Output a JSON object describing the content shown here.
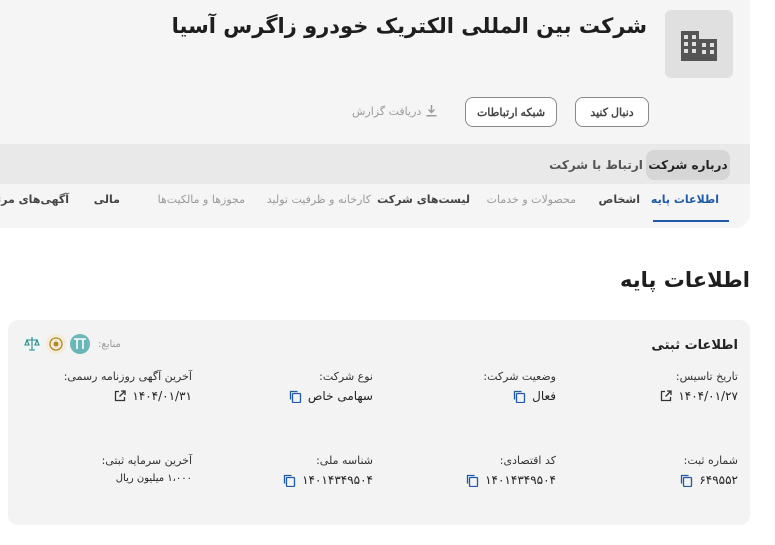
{
  "company": {
    "name": "شرکت بین المللی الکتریک خودرو زاگرس آسیا"
  },
  "actions": {
    "follow": "دنبال کنید",
    "network": "شبکه ارتباطات",
    "report": "دریافت گزارش"
  },
  "toggles": {
    "about": "درباره شرکت",
    "contact": "ارتباط با شرکت"
  },
  "tabs": [
    {
      "label": "اطلاعات پایه",
      "active": true
    },
    {
      "label": "اشخاص"
    },
    {
      "label": "محصولات و خدمات"
    },
    {
      "label": "لیست‌های شرکت"
    },
    {
      "label": "کارخانه و ظرفیت تولید"
    },
    {
      "label": "مجوزها و مالکیت‌ها"
    },
    {
      "label": "مالی"
    },
    {
      "label": "آگهی‌های مرتبط"
    }
  ],
  "section_title": "اطلاعات پایه",
  "registration": {
    "title": "اطلاعات ثبتی",
    "sources_label": "منابع:",
    "fields": [
      {
        "label": "تاریخ تاسیس:",
        "value": "۱۴۰۴/۰۱/۲۷"
      },
      {
        "label": "وضعیت شرکت:",
        "value": "فعال"
      },
      {
        "label": "نوع شرکت:",
        "value": "سهامی خاص"
      },
      {
        "label": "آخرین آگهی روزنامه رسمی:",
        "value": "۱۴۰۴/۰۱/۳۱"
      },
      {
        "label": "شماره ثبت:",
        "value": "۶۴۹۵۵۲"
      },
      {
        "label": "کد اقتصادی:",
        "value": "۱۴۰۱۴۳۴۹۵۰۴"
      },
      {
        "label": "شناسه ملی:",
        "value": "۱۴۰۱۴۳۴۹۵۰۴"
      },
      {
        "label": "آخرین سرمایه ثبتی:",
        "value": "۱،۰۰۰ میلیون ریال"
      }
    ]
  },
  "colors": {
    "accent": "#1f5aa6",
    "header_bg": "#f5f5f5",
    "card_bg": "#f3f3f3"
  }
}
